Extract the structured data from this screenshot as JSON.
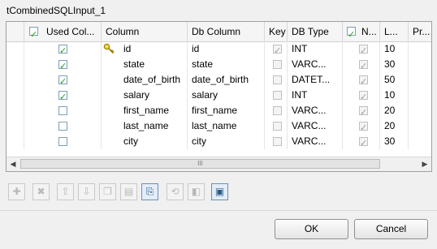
{
  "window": {
    "title": "tCombinedSQLInput_1"
  },
  "table": {
    "headers": {
      "used": "Used Col...",
      "column": "Column",
      "db_column": "Db Column",
      "key": "Key",
      "db_type": "DB Type",
      "nullable": "N...",
      "length": "L...",
      "precision": "Pr..."
    },
    "header_used_checked": true,
    "header_nullable_checked": true,
    "rows": [
      {
        "used": true,
        "column": "id",
        "db_column": "id",
        "key": true,
        "db_type": "INT",
        "nullable": true,
        "length": "10",
        "is_key_icon": true
      },
      {
        "used": true,
        "column": "state",
        "db_column": "state",
        "key": false,
        "db_type": "VARC...",
        "nullable": true,
        "length": "30"
      },
      {
        "used": true,
        "column": "date_of_birth",
        "db_column": "date_of_birth",
        "key": false,
        "db_type": "DATET...",
        "nullable": true,
        "length": "50"
      },
      {
        "used": true,
        "column": "salary",
        "db_column": "salary",
        "key": false,
        "db_type": "INT",
        "nullable": true,
        "length": "10"
      },
      {
        "used": false,
        "column": "first_name",
        "db_column": "first_name",
        "key": false,
        "db_type": "VARC...",
        "nullable": true,
        "length": "20"
      },
      {
        "used": false,
        "column": "last_name",
        "db_column": "last_name",
        "key": false,
        "db_type": "VARC...",
        "nullable": true,
        "length": "20"
      },
      {
        "used": false,
        "column": "city",
        "db_column": "city",
        "key": false,
        "db_type": "VARC...",
        "nullable": true,
        "length": "30"
      }
    ]
  },
  "scrollbar": {
    "thumb_grip": "III"
  },
  "toolbar": {
    "buttons": [
      {
        "name": "add-row-button",
        "icon": "plus-icon",
        "glyph": "✚",
        "enabled": false
      },
      {
        "name": "remove-row-button",
        "icon": "x-icon",
        "glyph": "✖",
        "enabled": false
      },
      {
        "name": "move-up-button",
        "icon": "arrow-up-icon",
        "glyph": "⇧",
        "enabled": false
      },
      {
        "name": "move-down-button",
        "icon": "arrow-down-icon",
        "glyph": "⇩",
        "enabled": false
      },
      {
        "name": "copy-button",
        "icon": "copy-icon",
        "glyph": "❐",
        "enabled": false
      },
      {
        "name": "paste-button",
        "icon": "paste-icon",
        "glyph": "▤",
        "enabled": false
      },
      {
        "name": "import-button",
        "icon": "import-icon",
        "glyph": "⎘",
        "enabled": true
      },
      {
        "name": "reset-button",
        "icon": "reset-icon",
        "glyph": "⟲",
        "enabled": false
      },
      {
        "name": "export-button",
        "icon": "export-icon",
        "glyph": "◧",
        "enabled": false
      },
      {
        "name": "save-button",
        "icon": "save-icon",
        "glyph": "▣",
        "enabled": true
      }
    ]
  },
  "dialog": {
    "ok_label": "OK",
    "cancel_label": "Cancel"
  }
}
